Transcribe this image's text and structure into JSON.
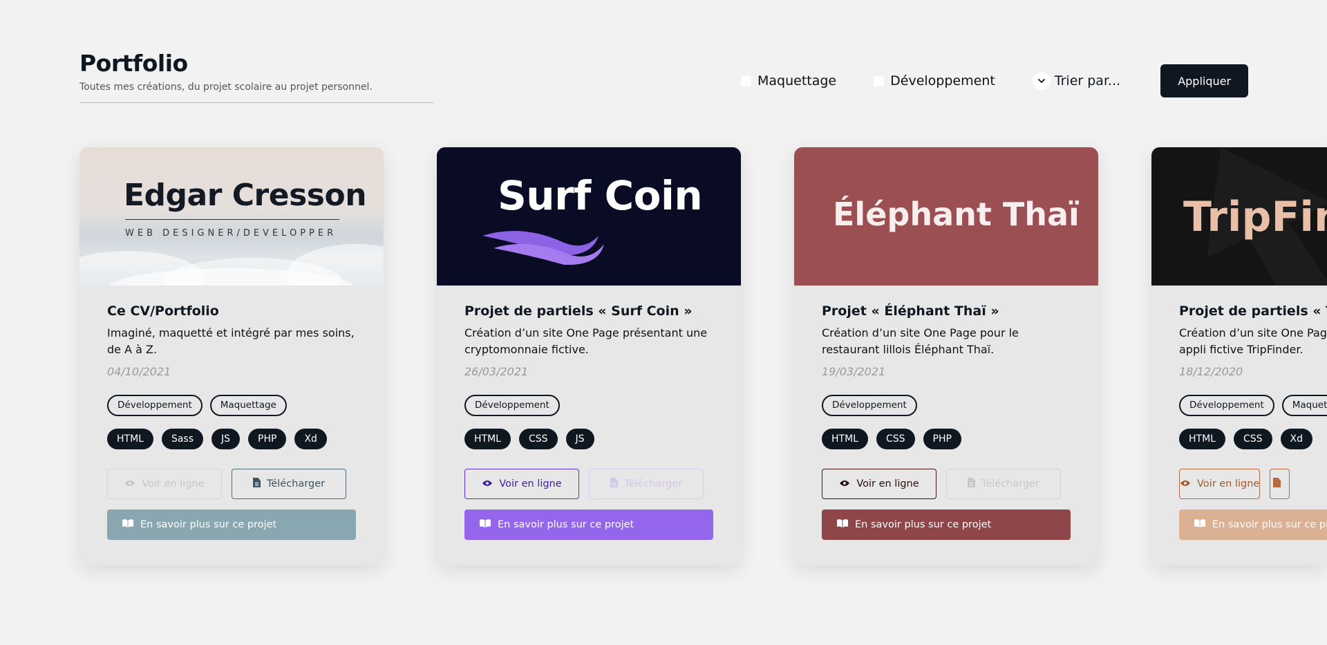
{
  "header": {
    "title": "Portfolio",
    "subtitle": "Toutes mes créations, du projet scolaire au projet personnel."
  },
  "filters": {
    "maquettage": "Maquettage",
    "developpement": "Développement",
    "sort": "Trier par...",
    "apply": "Appliquer"
  },
  "cards": [
    {
      "image_title": "Edgar Cresson",
      "image_subtitle": "WEB DESIGNER/DEVELOPPER",
      "title": "Ce CV/Portfolio",
      "desc": "Imaginé, maquetté et intégré par mes soins, de A à Z.",
      "date": "04/10/2021",
      "tags": [
        "Développement",
        "Maquettage"
      ],
      "techs": [
        "HTML",
        "Sass",
        "JS",
        "PHP",
        "Xd"
      ],
      "view": "Voir en ligne",
      "download": "Télécharger",
      "more": "En savoir plus sur ce projet",
      "view_enabled": false,
      "download_enabled": true,
      "accent": "#89a7b1"
    },
    {
      "image_title": "Surf Coin",
      "title": "Projet de partiels « Surf Coin »",
      "desc": "Création d’un site One Page présentant une cryptomonnaie fictive.",
      "date": "26/03/2021",
      "tags": [
        "Développement"
      ],
      "techs": [
        "HTML",
        "CSS",
        "JS"
      ],
      "view": "Voir en ligne",
      "download": "Télécharger",
      "more": "En savoir plus sur ce projet",
      "view_enabled": true,
      "download_enabled": false,
      "accent": "#9466ec"
    },
    {
      "image_title": "Éléphant Thaï",
      "title": "Projet « Éléphant Thaï »",
      "desc": "Création d’un site One Page pour le restaurant lillois Éléphant Thaï.",
      "date": "19/03/2021",
      "tags": [
        "Développement"
      ],
      "techs": [
        "HTML",
        "CSS",
        "PHP"
      ],
      "view": "Voir en ligne",
      "download": "Télécharger",
      "more": "En savoir plus sur ce projet",
      "view_enabled": true,
      "download_enabled": false,
      "accent": "#8e4649"
    },
    {
      "image_title": "TripFin",
      "title": "Projet de partiels « Trip",
      "desc": "Création d’un site One Page appli fictive TripFinder.",
      "date": "18/12/2020",
      "tags": [
        "Développement",
        "Maquet"
      ],
      "techs": [
        "HTML",
        "CSS",
        "Xd"
      ],
      "view": "Voir en ligne",
      "more": "En savoir plus sur ce proje",
      "view_enabled": true,
      "accent": "#dcb093"
    }
  ],
  "icons": {
    "eye": "eye-icon",
    "file": "file-icon",
    "book": "book-icon",
    "chevron": "chevron-down-icon"
  }
}
